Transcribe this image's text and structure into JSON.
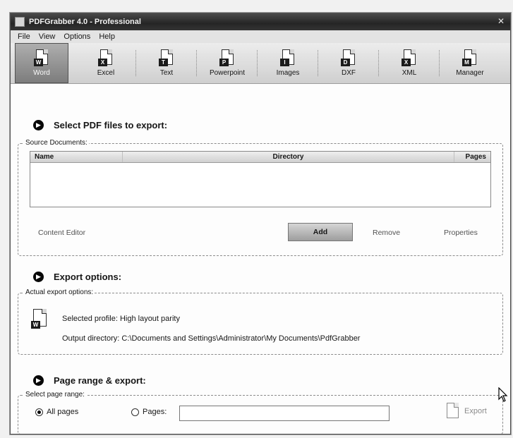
{
  "window": {
    "title": "PDFGrabber 4.0 - Professional"
  },
  "menu": [
    "File",
    "View",
    "Options",
    "Help"
  ],
  "toolbar": {
    "items": [
      {
        "label": "Word",
        "badge": "W",
        "active": true
      },
      {
        "label": "Excel",
        "badge": "X",
        "active": false
      },
      {
        "label": "Text",
        "badge": "T",
        "active": false
      },
      {
        "label": "Powerpoint",
        "badge": "P",
        "active": false
      },
      {
        "label": "Images",
        "badge": "I",
        "active": false
      },
      {
        "label": "DXF",
        "badge": "D",
        "active": false
      },
      {
        "label": "XML",
        "badge": "X",
        "active": false
      },
      {
        "label": "Manager",
        "badge": "M",
        "active": false
      }
    ]
  },
  "source": {
    "heading": "Select PDF files to export:",
    "group_label": "Source Documents:",
    "columns": {
      "name": "Name",
      "directory": "Directory",
      "pages": "Pages"
    },
    "rows": [],
    "buttons": {
      "content_editor": "Content Editor",
      "add": "Add",
      "remove": "Remove",
      "properties": "Properties"
    }
  },
  "export_options": {
    "heading": "Export options:",
    "group_label": "Actual export options:",
    "profile_label": "Selected profile:",
    "profile_value": "High layout parity",
    "output_label": "Output directory:",
    "output_value": "C:\\Documents and Settings\\Administrator\\My Documents\\PdfGrabber",
    "profile_icon_badge": "W"
  },
  "page_range": {
    "heading": "Page range & export:",
    "group_label": "Select page range:",
    "all_pages_label": "All pages",
    "all_pages_checked": true,
    "pages_label": "Pages:",
    "pages_checked": false,
    "pages_value": "",
    "export_label": "Export"
  }
}
